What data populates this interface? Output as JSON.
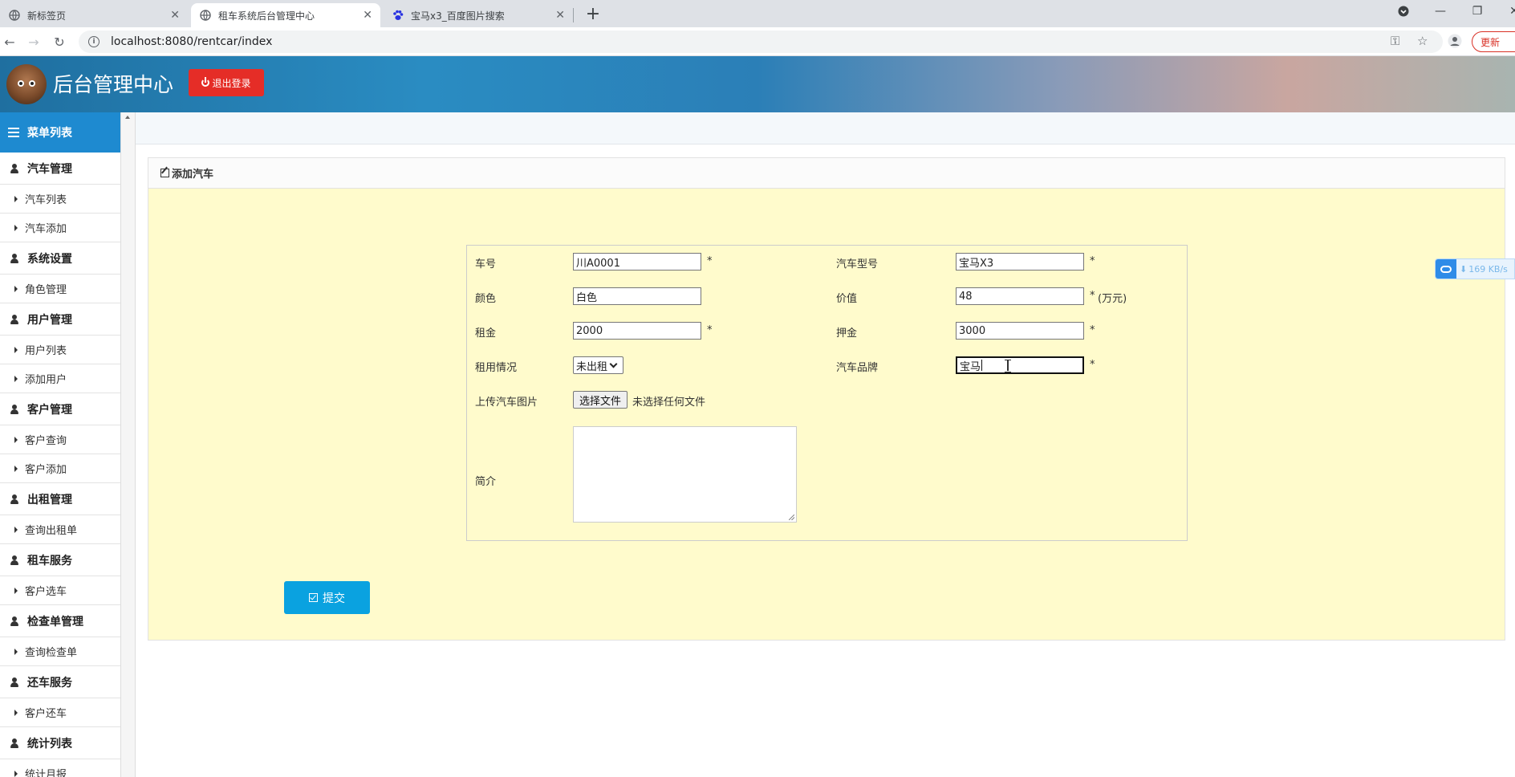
{
  "browser": {
    "tabs": [
      {
        "title": "新标签页"
      },
      {
        "title": "租车系统后台管理中心"
      },
      {
        "title": "宝马x3_百度图片搜索"
      }
    ],
    "url": "localhost:8080/rentcar/index",
    "update_label": "更新"
  },
  "header": {
    "title": "后台管理中心",
    "logout_label": "退出登录"
  },
  "sidebar": {
    "title": "菜单列表",
    "groups": [
      {
        "label": "汽车管理",
        "items": [
          "汽车列表",
          "汽车添加"
        ]
      },
      {
        "label": "系统设置",
        "items": [
          "角色管理"
        ]
      },
      {
        "label": "用户管理",
        "items": [
          "用户列表",
          "添加用户"
        ]
      },
      {
        "label": "客户管理",
        "items": [
          "客户查询",
          "客户添加"
        ]
      },
      {
        "label": "出租管理",
        "items": [
          "查询出租单"
        ]
      },
      {
        "label": "租车服务",
        "items": [
          "客户选车"
        ]
      },
      {
        "label": "检查单管理",
        "items": [
          "查询检查单"
        ]
      },
      {
        "label": "还车服务",
        "items": [
          "客户还车"
        ]
      },
      {
        "label": "统计列表",
        "items": [
          "统计月报"
        ]
      }
    ]
  },
  "panel": {
    "title": "添加汽车"
  },
  "form": {
    "car_no_label": "车号",
    "car_no_value": "川A0001",
    "model_label": "汽车型号",
    "model_value": "宝马X3",
    "color_label": "颜色",
    "color_value": "白色",
    "price_label": "价值",
    "price_value": "48",
    "price_unit": "(万元)",
    "rent_label": "租金",
    "rent_value": "2000",
    "deposit_label": "押金",
    "deposit_value": "3000",
    "status_label": "租用情况",
    "status_value": "未出租",
    "brand_label": "汽车品牌",
    "brand_value": "宝马",
    "image_label": "上传汽车图片",
    "file_button": "选择文件",
    "file_status": "未选择任何文件",
    "intro_label": "简介",
    "required_mark": "*",
    "submit_label": "提交"
  },
  "download_widget": {
    "speed": "169 KB/s"
  }
}
